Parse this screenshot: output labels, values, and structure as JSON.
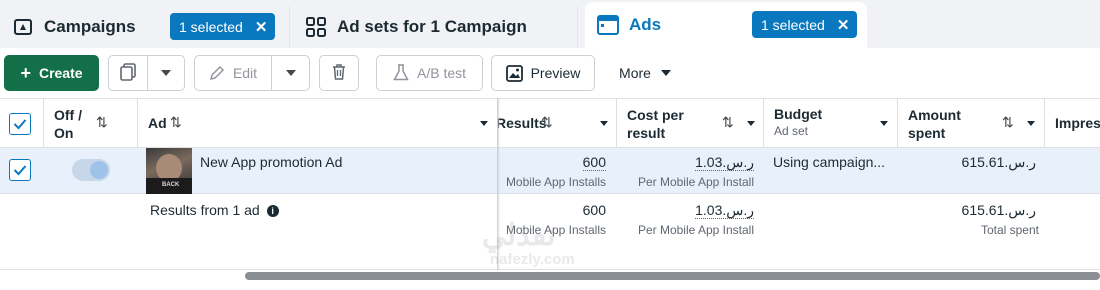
{
  "tabs": {
    "campaigns": {
      "label": "Campaigns",
      "selected_badge": "1 selected"
    },
    "adsets": {
      "label": "Ad sets for 1 Campaign"
    },
    "ads": {
      "label": "Ads",
      "selected_badge": "1 selected"
    }
  },
  "toolbar": {
    "create": "Create",
    "edit": "Edit",
    "ab_test": "A/B test",
    "preview": "Preview",
    "more": "More"
  },
  "table": {
    "headers": {
      "off_on": "Off / On",
      "ad": "Ad",
      "results": "Results",
      "cost_per_result": "Cost per result",
      "budget": "Budget",
      "budget_sub": "Ad set",
      "amount_spent": "Amount spent",
      "impressions": "Impres"
    },
    "row": {
      "ad_name": "New App promotion Ad",
      "results_value": "600",
      "results_type": "Mobile App Installs",
      "cost_value": "ر.س.1.03",
      "cost_type": "Per Mobile App Install",
      "budget": "Using campaign...",
      "amount_spent": "ر.س.615.61",
      "thumbnail_text": "BACK"
    },
    "summary": {
      "label": "Results from 1 ad",
      "results_value": "600",
      "results_type": "Mobile App Installs",
      "cost_value": "ر.س.1.03",
      "cost_type": "Per Mobile App Install",
      "amount_spent": "ر.س.615.61",
      "amount_label": "Total spent"
    }
  },
  "watermark": {
    "line1": "نفذلي",
    "line2": "nafezly.com"
  },
  "colors": {
    "accent": "#0a78be",
    "create_green": "#136f48",
    "selected_row": "#e7f0fb"
  }
}
